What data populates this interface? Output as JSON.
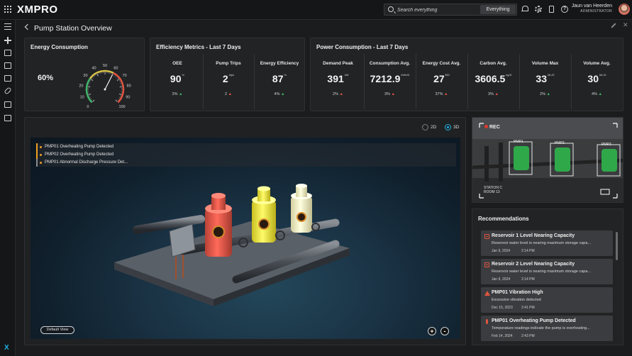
{
  "app": {
    "logo": "XMPRO"
  },
  "search": {
    "placeholder": "Search everything",
    "scope": "Everything"
  },
  "user": {
    "name": "Jaun van Heerden",
    "role": "ADMINISTRATOR"
  },
  "page": {
    "title": "Pump Station Overview"
  },
  "energy": {
    "title": "Energy Consumption",
    "value_label": "60%",
    "value": 60,
    "gauge_ticks": [
      "0",
      "10",
      "20",
      "30",
      "40",
      "50",
      "60",
      "70",
      "80",
      "90",
      "100"
    ]
  },
  "efficiency": {
    "title": "Efficiency Metrics - Last 7 Days",
    "metrics": [
      {
        "label": "OEE",
        "value": "90",
        "unit": "%",
        "delta": "3%",
        "trend": "up"
      },
      {
        "label": "Pump Trips",
        "value": "2",
        "unit": "trips",
        "delta": "2",
        "trend": "up-red"
      },
      {
        "label": "Energy Efficiency",
        "value": "87",
        "unit": "%",
        "delta": "4%",
        "trend": "up"
      }
    ]
  },
  "power": {
    "title": "Power Consumption - Last 7 Days",
    "metrics": [
      {
        "label": "Demand Peak",
        "value": "391",
        "unit": "kW",
        "delta": "2%",
        "trend": "up-red"
      },
      {
        "label": "Consumption Avg.",
        "value": "7212.9",
        "unit": "kWh/D",
        "delta": "3%",
        "trend": "up-red"
      },
      {
        "label": "Energy Cost Avg.",
        "value": "27",
        "unit": "$/D",
        "delta": "37%",
        "trend": "up-red"
      },
      {
        "label": "Carbon Avg.",
        "value": "3606.5",
        "unit": "kg/D",
        "delta": "3%",
        "trend": "up-red"
      },
      {
        "label": "Volume Max",
        "value": "33",
        "unit": "ML/D",
        "delta": "2%",
        "trend": "up"
      },
      {
        "label": "Volume Avg.",
        "value": "30",
        "unit": "ML/D",
        "delta": "4%",
        "trend": "up"
      }
    ]
  },
  "viewer": {
    "mode_2d": "2D",
    "mode_3d": "3D",
    "selected_mode": "3D",
    "alerts": [
      {
        "text": "PMP01 Overheating Pump Detected",
        "level": "orange"
      },
      {
        "text": "PMP02 Overheating Pump Detected",
        "level": "orange"
      },
      {
        "text": "PMP01 Abnormal Discharge Pressure Det...",
        "level": "grey"
      }
    ],
    "default_view": "Default View",
    "zoom_in": "+",
    "zoom_out": "-"
  },
  "camera": {
    "rec": "REC",
    "pumps": [
      "PMP1",
      "PMP2",
      "PMP3"
    ],
    "location_line1": "STATION C",
    "location_line2": "ROOM 13"
  },
  "recommendations": {
    "title": "Recommendations",
    "items": [
      {
        "icon": "reservoir-icon",
        "title": "Reservoir 1 Level Nearing Capacity",
        "desc": "Reservoir water level is nearing maximum storage capa...",
        "date": "Jan 9, 2024",
        "time": "2:14 PM"
      },
      {
        "icon": "reservoir-icon",
        "title": "Reservoir 2 Level Nearing Capacity",
        "desc": "Reservoir water level is nearing maximum storage capa...",
        "date": "Jan 9, 2024",
        "time": "2:14 PM"
      },
      {
        "icon": "warning-icon",
        "title": "PMP01 Vibration High",
        "desc": "Excessive vibration detected",
        "date": "Dec 15, 2023",
        "time": "2:41 PM"
      },
      {
        "icon": "thermometer-icon",
        "title": "PMP01 Overheating Pump Detected",
        "desc": "Temperature readings indicate the pump is overheating...",
        "date": "Feb 14, 2024",
        "time": "2:43 PM"
      }
    ]
  },
  "colors": {
    "accent": "#1fb3e8",
    "positive": "#3fb56a",
    "negative": "#e0543f",
    "alert": "#f0a020"
  }
}
